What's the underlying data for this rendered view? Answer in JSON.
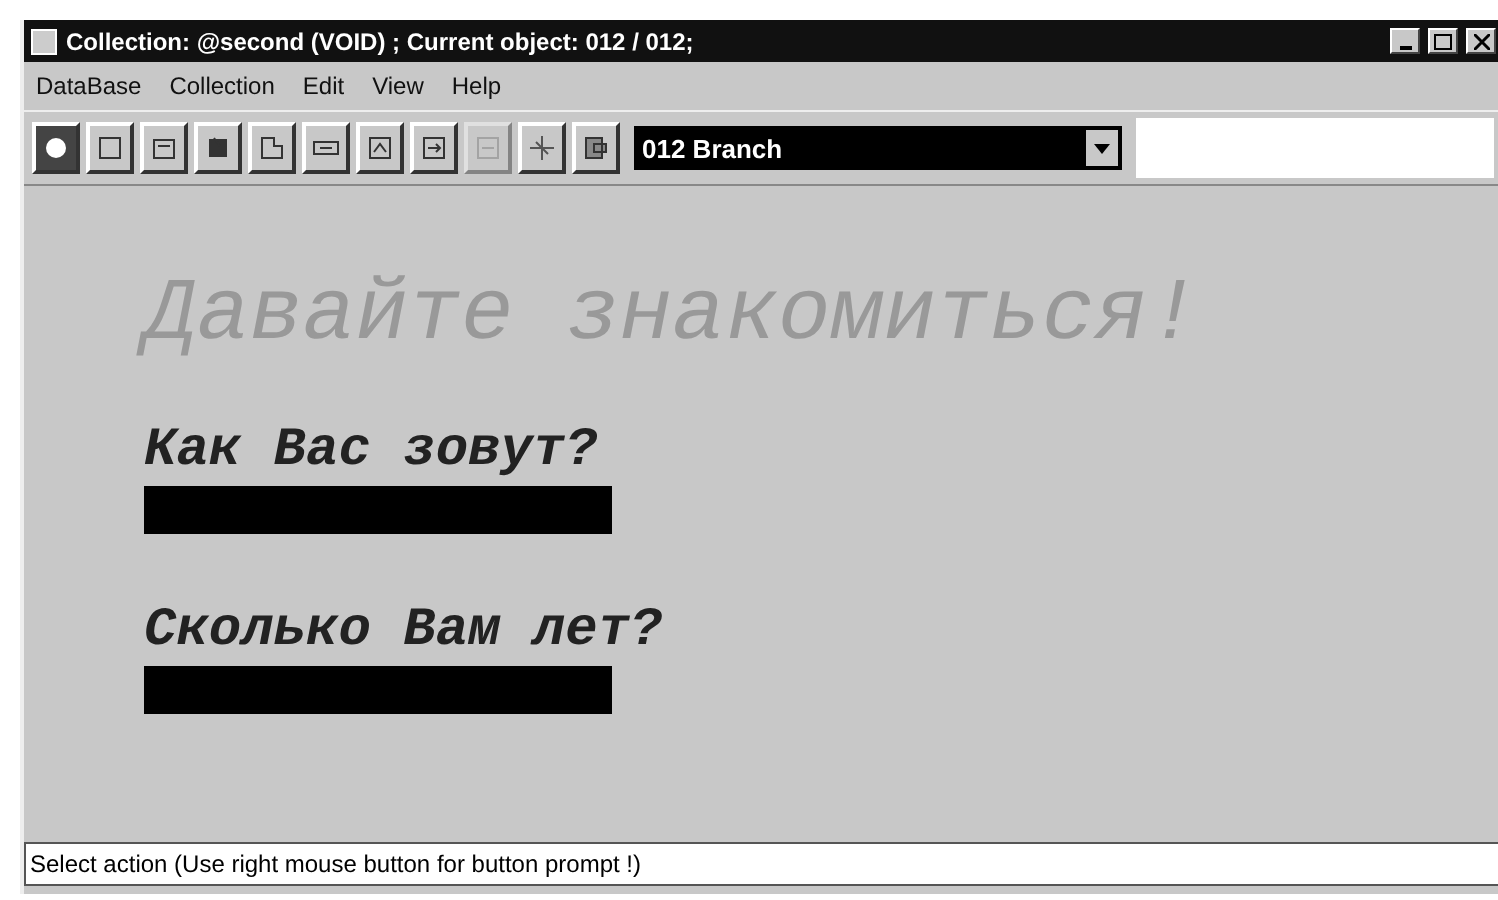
{
  "window": {
    "title": "Collection: @second (VOID) ;  Current object: 012 / 012;"
  },
  "menu": [
    "DataBase",
    "Collection",
    "Edit",
    "View",
    "Help"
  ],
  "toolbar": [
    {
      "disabled": false,
      "selected": true
    },
    {
      "disabled": false,
      "selected": false
    },
    {
      "disabled": false,
      "selected": false
    },
    {
      "disabled": false,
      "selected": false
    },
    {
      "disabled": false,
      "selected": false
    },
    {
      "disabled": false,
      "selected": false
    },
    {
      "disabled": false,
      "selected": false
    },
    {
      "disabled": false,
      "selected": false
    },
    {
      "disabled": true,
      "selected": false
    },
    {
      "disabled": false,
      "selected": false
    },
    {
      "disabled": false,
      "selected": false
    }
  ],
  "object_select": {
    "value": "012 Branch"
  },
  "form": {
    "heading": "Давайте знакомиться!",
    "fields": [
      {
        "label": "Как Вас зовут?"
      },
      {
        "label": "Сколько Вам лет?"
      }
    ]
  },
  "status_bar": "Select action (Use right mouse button for button prompt !)"
}
